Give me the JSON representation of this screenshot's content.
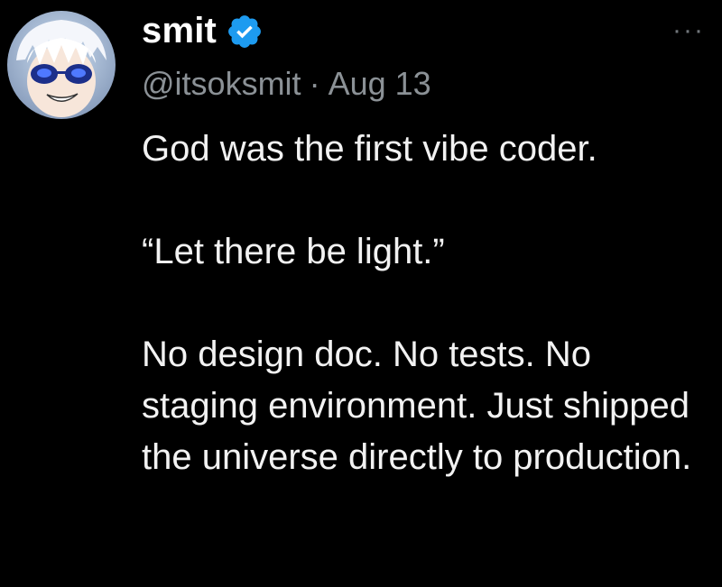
{
  "author": {
    "display_name": "smit",
    "handle": "@itsoksmit",
    "separator": "·",
    "date": "Aug 13",
    "verified": true
  },
  "tweet": {
    "paragraphs": [
      "God was the first vibe coder.",
      "“Let there be light.”",
      "No design doc. No tests. No staging environment. Just shipped the universe directly to production."
    ]
  },
  "more_menu": {
    "label": "···",
    "icon": "more-horizontal-icon"
  },
  "colors": {
    "background": "#000000",
    "text": "#f2f2f2",
    "secondary": "#8b9196",
    "verified_badge": "#1d9bf0"
  }
}
